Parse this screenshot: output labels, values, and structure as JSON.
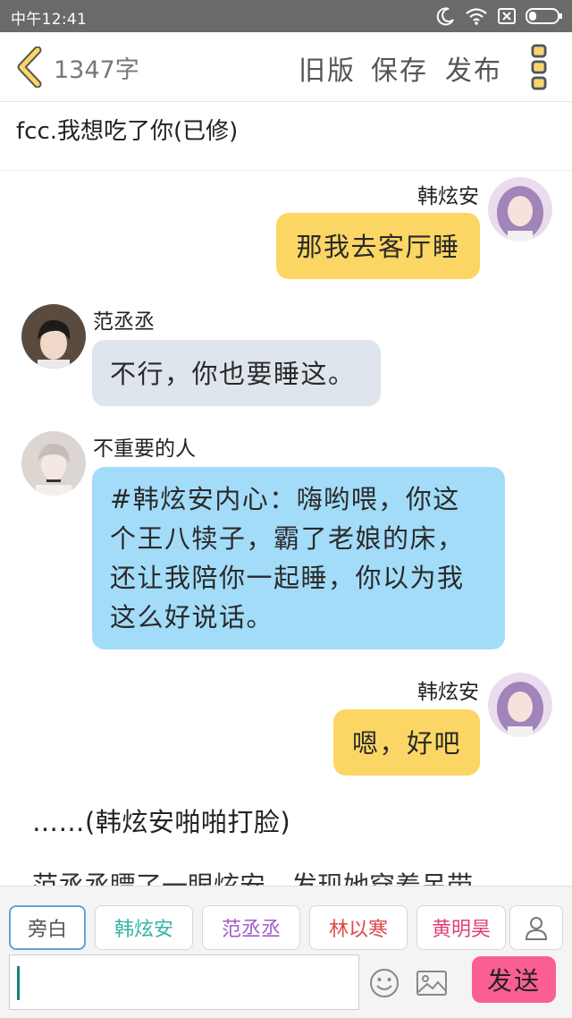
{
  "status_bar": {
    "time": "中午12:41"
  },
  "header": {
    "word_count": "1347字",
    "old_version": "旧版",
    "save": "保存",
    "publish": "发布"
  },
  "story_title": "fcc.我想吃了你(已修)",
  "messages": [
    {
      "speaker": "韩炫安",
      "text": "那我去客厅睡"
    },
    {
      "speaker": "范丞丞",
      "text": "不行，你也要睡这。"
    },
    {
      "speaker": "不重要的人",
      "lines": [
        "#韩炫安内心：嗨哟喂，你这",
        "个王八犊子，霸了老娘的床，",
        "还让我陪你一起睡，你以为我",
        "这么好说话。"
      ]
    },
    {
      "speaker": "韩炫安",
      "text": "嗯，好吧"
    }
  ],
  "narration": "……(韩炫安啪啪打脸)",
  "narration_cut": "范丞丞瞟了一眼炫安，发现她穿着吊带",
  "roles": [
    {
      "label": "旁白",
      "color": "#555555"
    },
    {
      "label": "韩炫安",
      "color": "#2fb6a8"
    },
    {
      "label": "范丞丞",
      "color": "#a05cc6"
    },
    {
      "label": "林以寒",
      "color": "#e04848"
    },
    {
      "label": "黄明昊",
      "color": "#e0407a"
    }
  ],
  "composer": {
    "value": "",
    "send_label": "发送"
  },
  "colors": {
    "accent_yellow": "#fcd664",
    "send_pink": "#fb5e93"
  }
}
